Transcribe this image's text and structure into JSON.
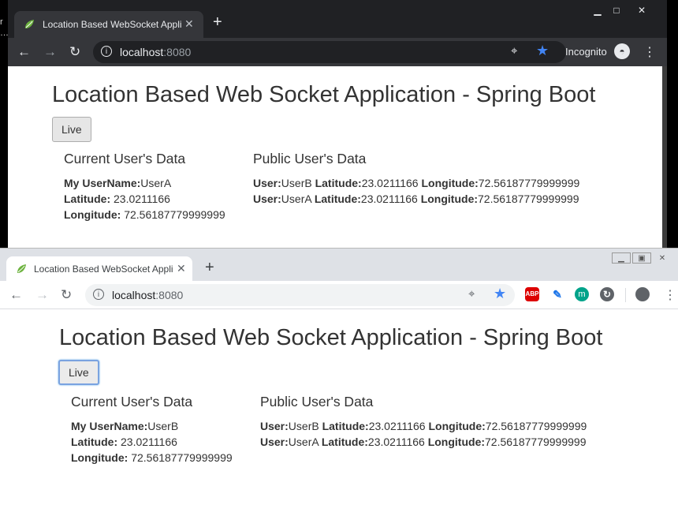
{
  "windows": [
    {
      "id": "incognito",
      "tab_title": "Location Based WebSocket Appli",
      "url_host": "localhost",
      "url_port": ":8080",
      "incognito_label": "Incognito",
      "page": {
        "title": "Location Based Web Socket Application - Spring Boot",
        "live_button": "Live",
        "current_heading": "Current User's Data",
        "public_heading": "Public User's Data",
        "current": {
          "username_label": "My UserName:",
          "username": "UserA",
          "lat_label": "Latitude:",
          "lat": " 23.0211166",
          "lng_label": "Longitude:",
          "lng": " 72.56187779999999"
        },
        "public_users": [
          {
            "user_label": "User:",
            "user": "UserB",
            "lat_label": "Latitude:",
            "lat": "23.0211166",
            "lng_label": "Longitude:",
            "lng": "72.56187779999999"
          },
          {
            "user_label": "User:",
            "user": "UserA",
            "lat_label": "Latitude:",
            "lat": "23.0211166",
            "lng_label": "Longitude:",
            "lng": "72.56187779999999"
          }
        ]
      }
    },
    {
      "id": "normal",
      "tab_title": "Location Based WebSocket Appli",
      "url_host": "localhost",
      "url_port": ":8080",
      "ext_abp": "ABP",
      "ext_m": "m",
      "page": {
        "title": "Location Based Web Socket Application - Spring Boot",
        "live_button": "Live",
        "current_heading": "Current User's Data",
        "public_heading": "Public User's Data",
        "current": {
          "username_label": "My UserName:",
          "username": "UserB",
          "lat_label": "Latitude:",
          "lat": " 23.0211166",
          "lng_label": "Longitude:",
          "lng": " 72.56187779999999"
        },
        "public_users": [
          {
            "user_label": "User:",
            "user": "UserB",
            "lat_label": "Latitude:",
            "lat": "23.0211166",
            "lng_label": "Longitude:",
            "lng": "72.56187779999999"
          },
          {
            "user_label": "User:",
            "user": "UserA",
            "lat_label": "Latitude:",
            "lat": "23.0211166",
            "lng_label": "Longitude:",
            "lng": "72.56187779999999"
          }
        ]
      }
    }
  ],
  "colors": {
    "incognito_frame": "#202124",
    "incognito_toolbar": "#35363a",
    "light_frame": "#dee1e6",
    "star": "#4285f4"
  },
  "icons": [
    "spring-leaf-icon",
    "close-icon",
    "plus-icon",
    "back-arrow-icon",
    "forward-arrow-icon",
    "reload-icon",
    "info-icon",
    "location-icon",
    "star-icon",
    "incognito-icon",
    "menu-icon",
    "eyedropper-icon",
    "sync-icon",
    "profile-icon"
  ]
}
